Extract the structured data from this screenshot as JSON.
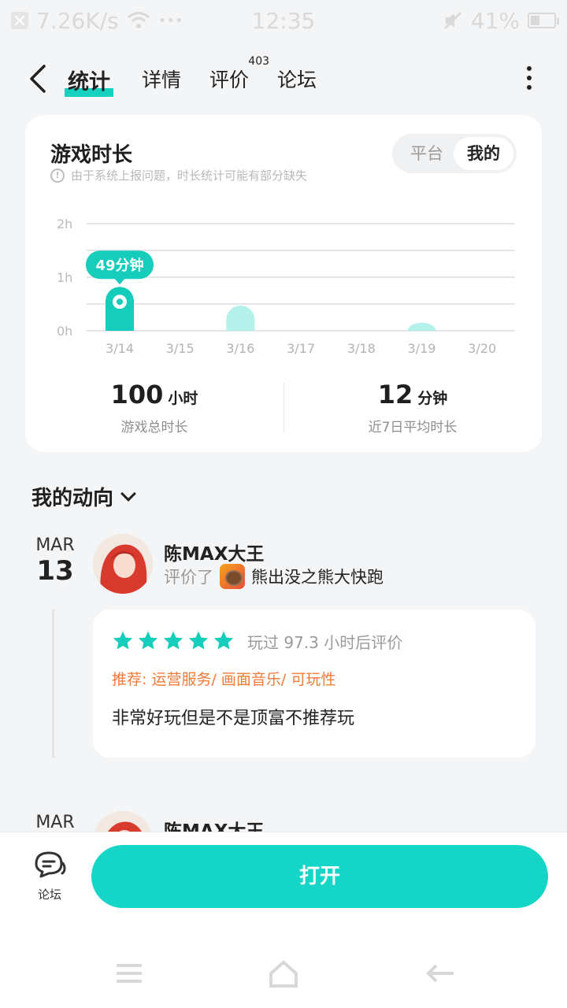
{
  "status_bar": {
    "speed": "7.26K/s",
    "dots": "•••",
    "time": "12:35",
    "battery": "41%",
    "battery_level": 0.41
  },
  "nav": {
    "tabs": [
      {
        "label": "统计",
        "active": true
      },
      {
        "label": "详情",
        "active": false
      },
      {
        "label": "评价",
        "active": false,
        "badge": "403"
      },
      {
        "label": "论坛",
        "active": false
      }
    ]
  },
  "stats": {
    "title": "游戏时长",
    "note": "由于系统上报问题，时长统计可能有部分缺失",
    "toggle": {
      "left": "平台",
      "right": "我的",
      "selected": "我的"
    },
    "total_value": "100",
    "total_unit": "小时",
    "total_label": "游戏总时长",
    "avg_value": "12",
    "avg_unit": "分钟",
    "avg_label": "近7日平均时长"
  },
  "chart_data": {
    "type": "bar",
    "categories": [
      "3/14",
      "3/15",
      "3/16",
      "3/17",
      "3/18",
      "3/19",
      "3/20"
    ],
    "values": [
      0.82,
      0,
      0.47,
      0,
      0,
      0.15,
      0
    ],
    "yticks": [
      "0h",
      "1h",
      "2h"
    ],
    "ylim": [
      0,
      2
    ],
    "tooltip": {
      "category": "3/14",
      "text": "49分钟"
    },
    "colors": {
      "highlight": "#16cdbb",
      "normal": "#b3f1ea"
    }
  },
  "trends": {
    "title": "我的动向",
    "entries": [
      {
        "month": "MAR",
        "day": "13",
        "user": "陈MAX大王",
        "action": "评价了",
        "game": "熊出没之熊大快跑",
        "rating": 5,
        "played": "玩过 97.3 小时后评价",
        "tags": "推荐: 运营服务/ 画面音乐/ 可玩性",
        "content": "非常好玩但是不是顶富不推荐玩"
      },
      {
        "month": "MAR",
        "user": "陈MAX大王"
      }
    ]
  },
  "bottom": {
    "forum_label": "论坛",
    "open_label": "打开"
  },
  "colors": {
    "accent": "#15d6c6",
    "tag": "#f07a37",
    "star": "#15cdbb"
  }
}
